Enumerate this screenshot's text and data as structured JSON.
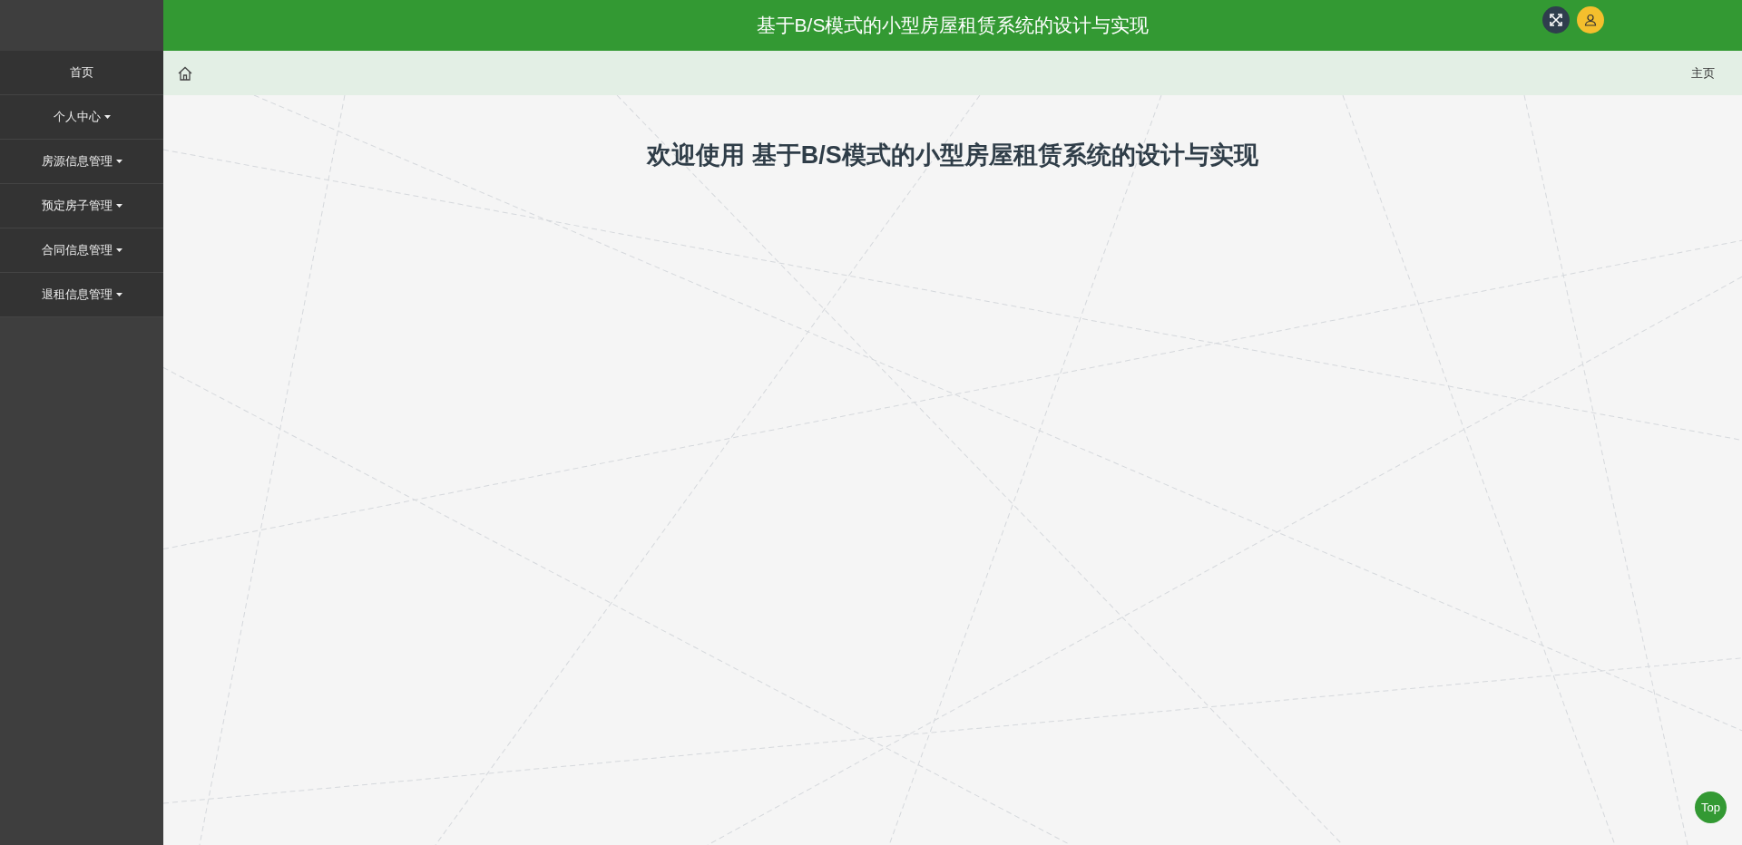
{
  "header": {
    "title": "基于B/S模式的小型房屋租赁系统的设计与实现"
  },
  "sidebar": {
    "items": [
      {
        "label": "首页",
        "kind": "link"
      },
      {
        "label": "个人中心",
        "kind": "dropdown"
      },
      {
        "label": "房源信息管理",
        "kind": "dropdown"
      },
      {
        "label": "预定房子管理",
        "kind": "dropdown"
      },
      {
        "label": "合同信息管理",
        "kind": "dropdown"
      },
      {
        "label": "退租信息管理",
        "kind": "dropdown"
      }
    ]
  },
  "breadcrumb": {
    "current": "主页"
  },
  "main": {
    "welcome": "欢迎使用 基于B/S模式的小型房屋租赁系统的设计与实现"
  },
  "back_to_top": {
    "label": "Top"
  }
}
